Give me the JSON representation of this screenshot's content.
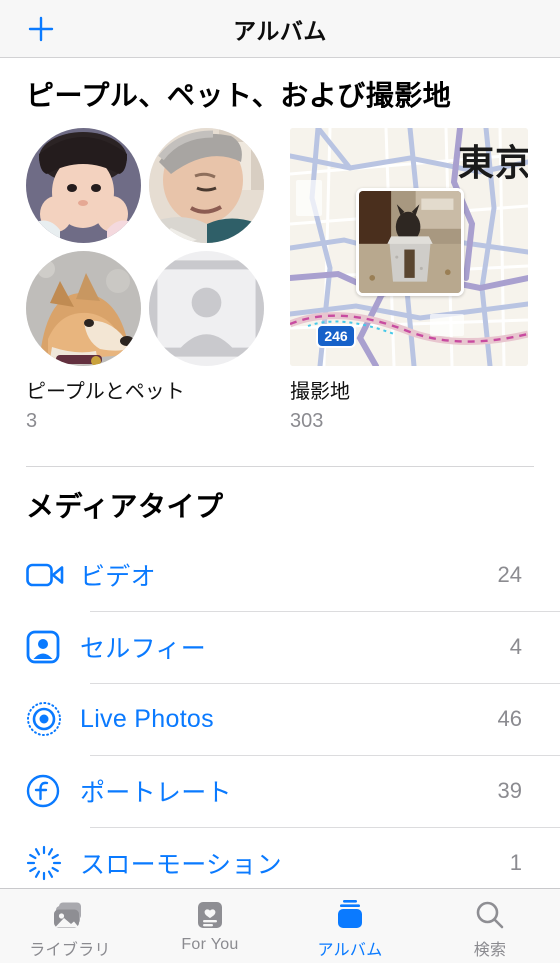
{
  "navbar": {
    "title": "アルバム",
    "add_label": "+",
    "accent_color": "#0a7aff"
  },
  "sections": {
    "people_places": {
      "title": "ピープル、ペット、および撮影地",
      "tiles": [
        {
          "name": "ピープルとペット",
          "count": "3",
          "icon": "people-pets-grid",
          "avatars": [
            {
              "name": "avatar-girl",
              "kind": "photo"
            },
            {
              "name": "avatar-elderly-woman",
              "kind": "photo"
            },
            {
              "name": "avatar-shiba-dog",
              "kind": "photo"
            },
            {
              "name": "avatar-placeholder",
              "kind": "placeholder"
            }
          ]
        },
        {
          "name": "撮影地",
          "count": "303",
          "icon": "map-tile",
          "map_label": "東京",
          "route_badge": "246"
        }
      ]
    },
    "media_types": {
      "title": "メディアタイプ",
      "rows": [
        {
          "icon": "video-camera-icon",
          "label": "ビデオ",
          "count": "24"
        },
        {
          "icon": "selfie-person-icon",
          "label": "セルフィー",
          "count": "4"
        },
        {
          "icon": "live-photo-icon",
          "label": "Live Photos",
          "count": "46"
        },
        {
          "icon": "portrait-aperture-icon",
          "label": "ポートレート",
          "count": "39"
        },
        {
          "icon": "slomo-burst-icon",
          "label": "スローモーション",
          "count": "1"
        }
      ]
    }
  },
  "tabbar": {
    "tabs": [
      {
        "icon": "photo-stack-icon",
        "label": "ライブラリ",
        "active": false
      },
      {
        "icon": "for-you-card-icon",
        "label": "For You",
        "active": false
      },
      {
        "icon": "albums-stack-icon",
        "label": "アルバム",
        "active": true
      },
      {
        "icon": "search-magnifier-icon",
        "label": "検索",
        "active": false
      }
    ]
  }
}
